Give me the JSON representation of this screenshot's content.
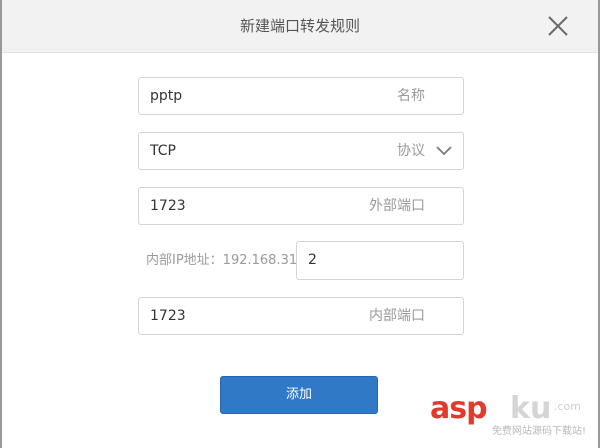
{
  "dialog": {
    "title": "新建端口转发规则",
    "close_icon": "close-icon"
  },
  "form": {
    "name_field": {
      "value": "pptp",
      "label": "名称"
    },
    "protocol_select": {
      "value": "TCP",
      "label": "协议",
      "icon": "chevron-down-icon"
    },
    "external_port_field": {
      "value": "1723",
      "label": "外部端口"
    },
    "internal_ip": {
      "prefix_label": "内部IP地址：192.168.31.",
      "last_octet": "2"
    },
    "internal_port_field": {
      "value": "1723",
      "label": "内部端口"
    }
  },
  "actions": {
    "add_label": "添加"
  },
  "watermark": {
    "brand_a": "asp",
    "brand_b": "ku",
    "brand_c": ".com",
    "tagline": "免费网站源码下载站!"
  },
  "colors": {
    "primary": "#2f79c6",
    "header_bg": "#f2f2f2",
    "border": "#d4d4d4",
    "label": "#9a9a9a",
    "text": "#333333",
    "watermark_red": "#e23a2c"
  }
}
